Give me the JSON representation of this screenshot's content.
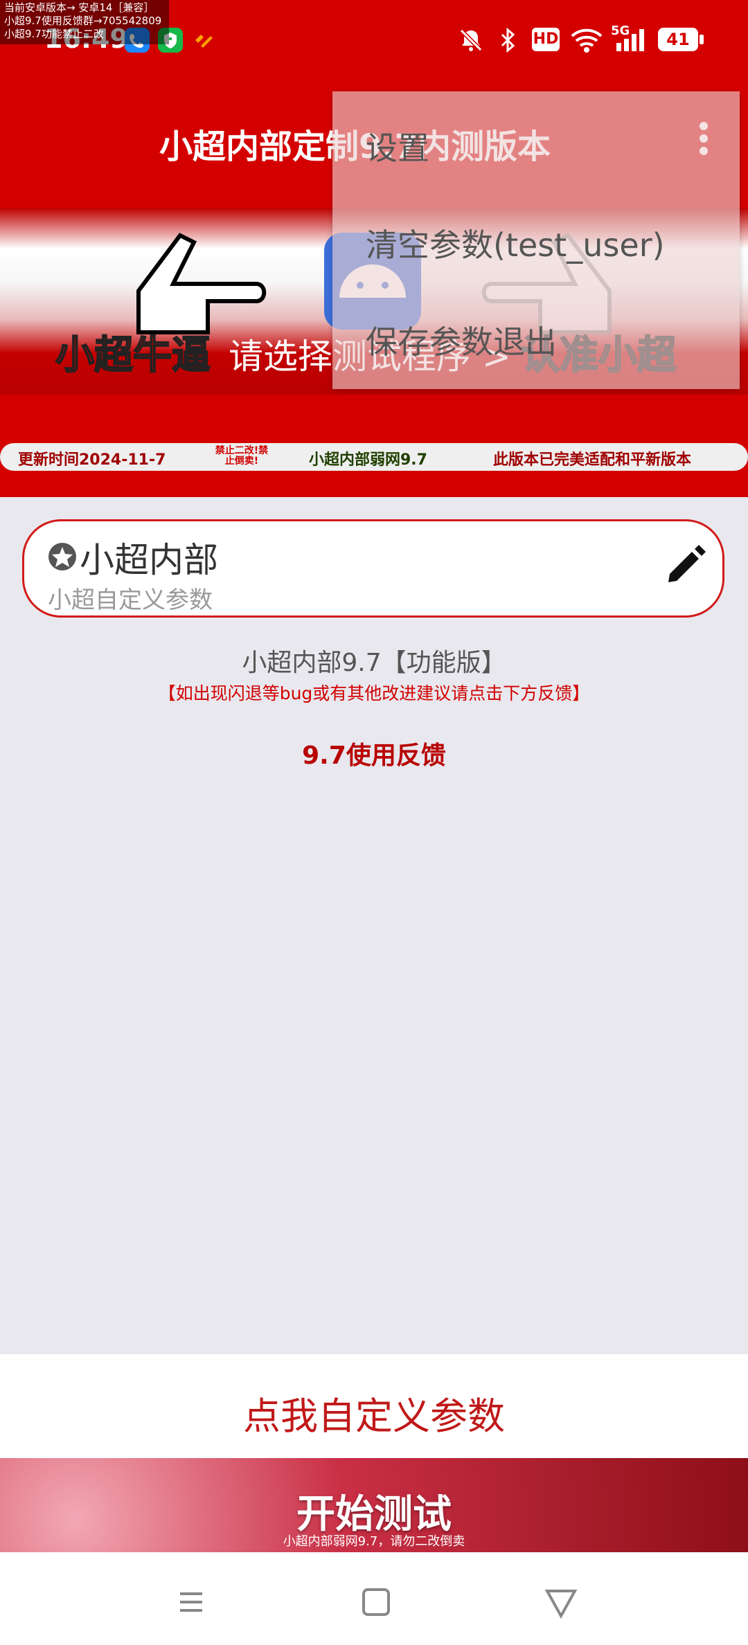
{
  "status_bar": {
    "time": "16:49",
    "notice_lines": [
      "当前安卓版本→ 安卓14［兼容］",
      "小超9.7使用反馈群→705542809",
      "小超9.7功能禁止二改"
    ],
    "battery": "41",
    "network": "5G",
    "hd": "HD"
  },
  "app_bar": {
    "title": "小超内部定制9.7内测版本"
  },
  "overflow_menu": {
    "items": [
      "设置",
      "清空参数(test_user)",
      "保存参数退出"
    ]
  },
  "banner": {
    "left_text": "小超牛逼",
    "middle_text": "请选择测试程序 >",
    "right_text": "认准小超",
    "ticker": {
      "update": "更新时间2024-11-7",
      "forbid": "禁止二改!禁止倒卖!",
      "name": "小超内部弱网9.7",
      "adapt": "此版本已完美适配和平新版本"
    }
  },
  "param_card": {
    "title": "小超内部",
    "subtitle": "小超自定义参数"
  },
  "version_text": "小超内部9.7【功能版】",
  "notice_text": "【如出现闪退等bug或有其他改进建议请点击下方反馈】",
  "feedback_link": "9.7使用反馈",
  "custom_button": "点我自定义参数",
  "start_button": {
    "label": "开始测试",
    "sub": "小超内部弱网9.7，请勿二改倒卖"
  },
  "colors": {
    "brand_red": "#d40000",
    "card_border": "#d21a1a"
  }
}
